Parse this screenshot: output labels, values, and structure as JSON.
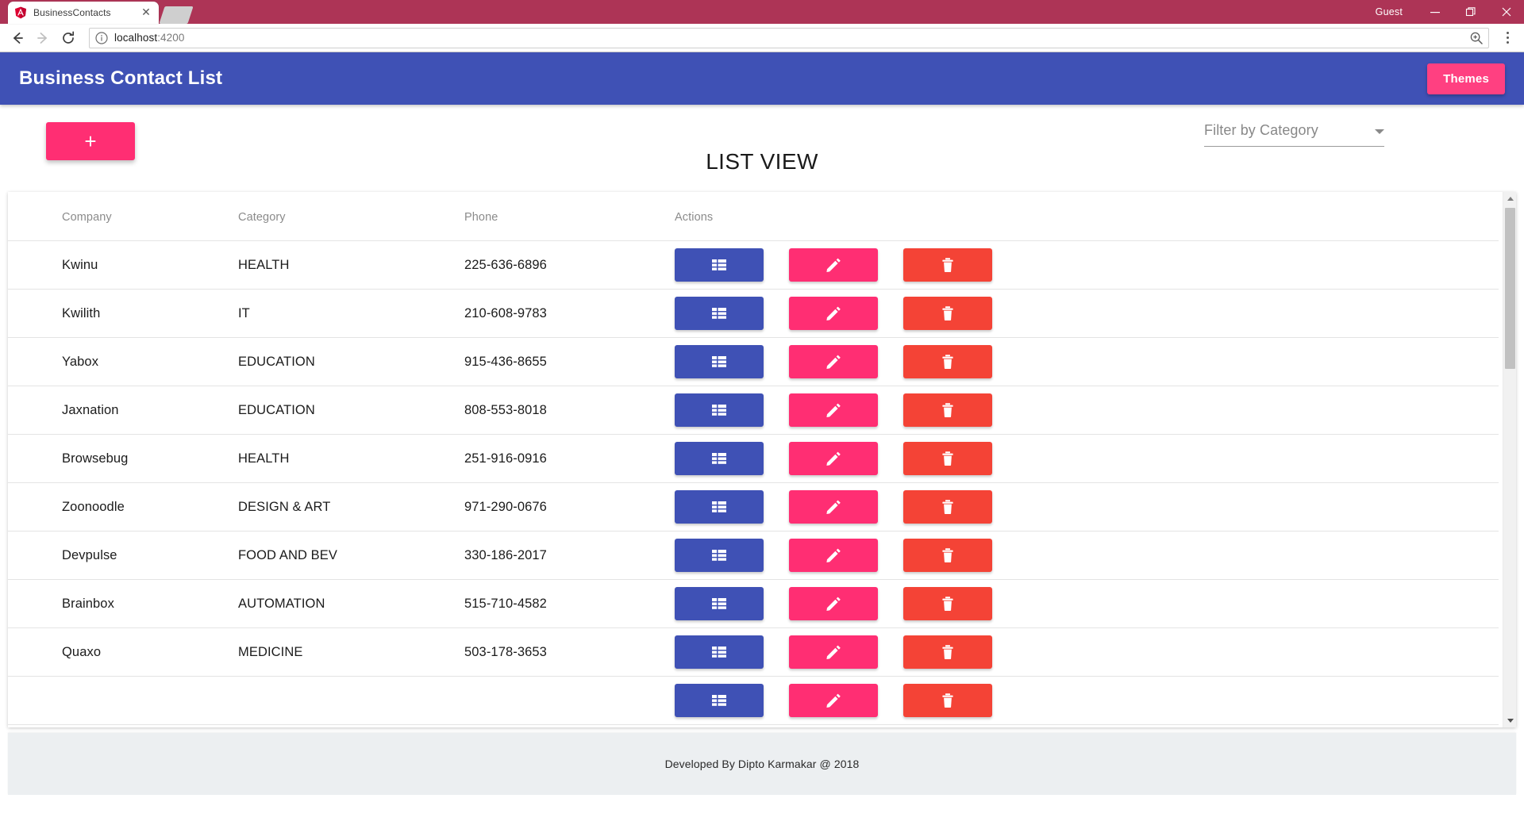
{
  "browser": {
    "tab": {
      "title": "BusinessContacts",
      "favicon_icon": "angular-logo-icon",
      "close_icon": "close-icon"
    },
    "new_tab_icon": "new-tab-icon",
    "profile_label": "Guest",
    "window_controls": {
      "minimize": "minimize-icon",
      "maximize": "maximize-icon",
      "close": "close-icon"
    },
    "nav": {
      "back_icon": "back-arrow-icon",
      "forward_icon": "forward-arrow-icon",
      "reload_icon": "reload-icon"
    },
    "omnibox": {
      "info_icon": "info-circle-icon",
      "url_host": "localhost",
      "url_port": ":4200",
      "zoom_icon": "zoom-in-icon"
    },
    "menu_icon": "three-dots-menu-icon"
  },
  "app": {
    "header": {
      "title": "Business Contact List",
      "themes_button": "Themes",
      "bg_color": "#3f51b5",
      "accent_color": "#ff4081"
    },
    "add_button": {
      "icon": "plus-icon",
      "glyph": "+",
      "color": "#ff2e73"
    },
    "list_title": "LIST VIEW",
    "filter": {
      "label": "Filter by Category",
      "caret_icon": "chevron-down-icon"
    },
    "table": {
      "columns": [
        "Company",
        "Category",
        "Phone",
        "Actions"
      ],
      "rows": [
        {
          "company": "Kwinu",
          "category": "HEALTH",
          "phone": "225-636-6896"
        },
        {
          "company": "Kwilith",
          "category": "IT",
          "phone": "210-608-9783"
        },
        {
          "company": "Yabox",
          "category": "EDUCATION",
          "phone": "915-436-8655"
        },
        {
          "company": "Jaxnation",
          "category": "EDUCATION",
          "phone": "808-553-8018"
        },
        {
          "company": "Browsebug",
          "category": "HEALTH",
          "phone": "251-916-0916"
        },
        {
          "company": "Zoonoodle",
          "category": "DESIGN & ART",
          "phone": "971-290-0676"
        },
        {
          "company": "Devpulse",
          "category": "FOOD AND BEV",
          "phone": "330-186-2017"
        },
        {
          "company": "Brainbox",
          "category": "AUTOMATION",
          "phone": "515-710-4582"
        },
        {
          "company": "Quaxo",
          "category": "MEDICINE",
          "phone": "503-178-3653"
        },
        {
          "company": "",
          "category": "",
          "phone": ""
        }
      ],
      "action_icons": {
        "view": "list-table-icon",
        "edit": "pencil-edit-icon",
        "delete": "trash-delete-icon"
      },
      "action_colors": {
        "view": "#3f51b5",
        "edit": "#ff2e73",
        "delete": "#f44336"
      },
      "scrollbar": {
        "up_icon": "scroll-up-arrow-icon",
        "down_icon": "scroll-down-arrow-icon"
      }
    },
    "footer": {
      "text": "Developed By Dipto Karmakar @ 2018"
    }
  }
}
